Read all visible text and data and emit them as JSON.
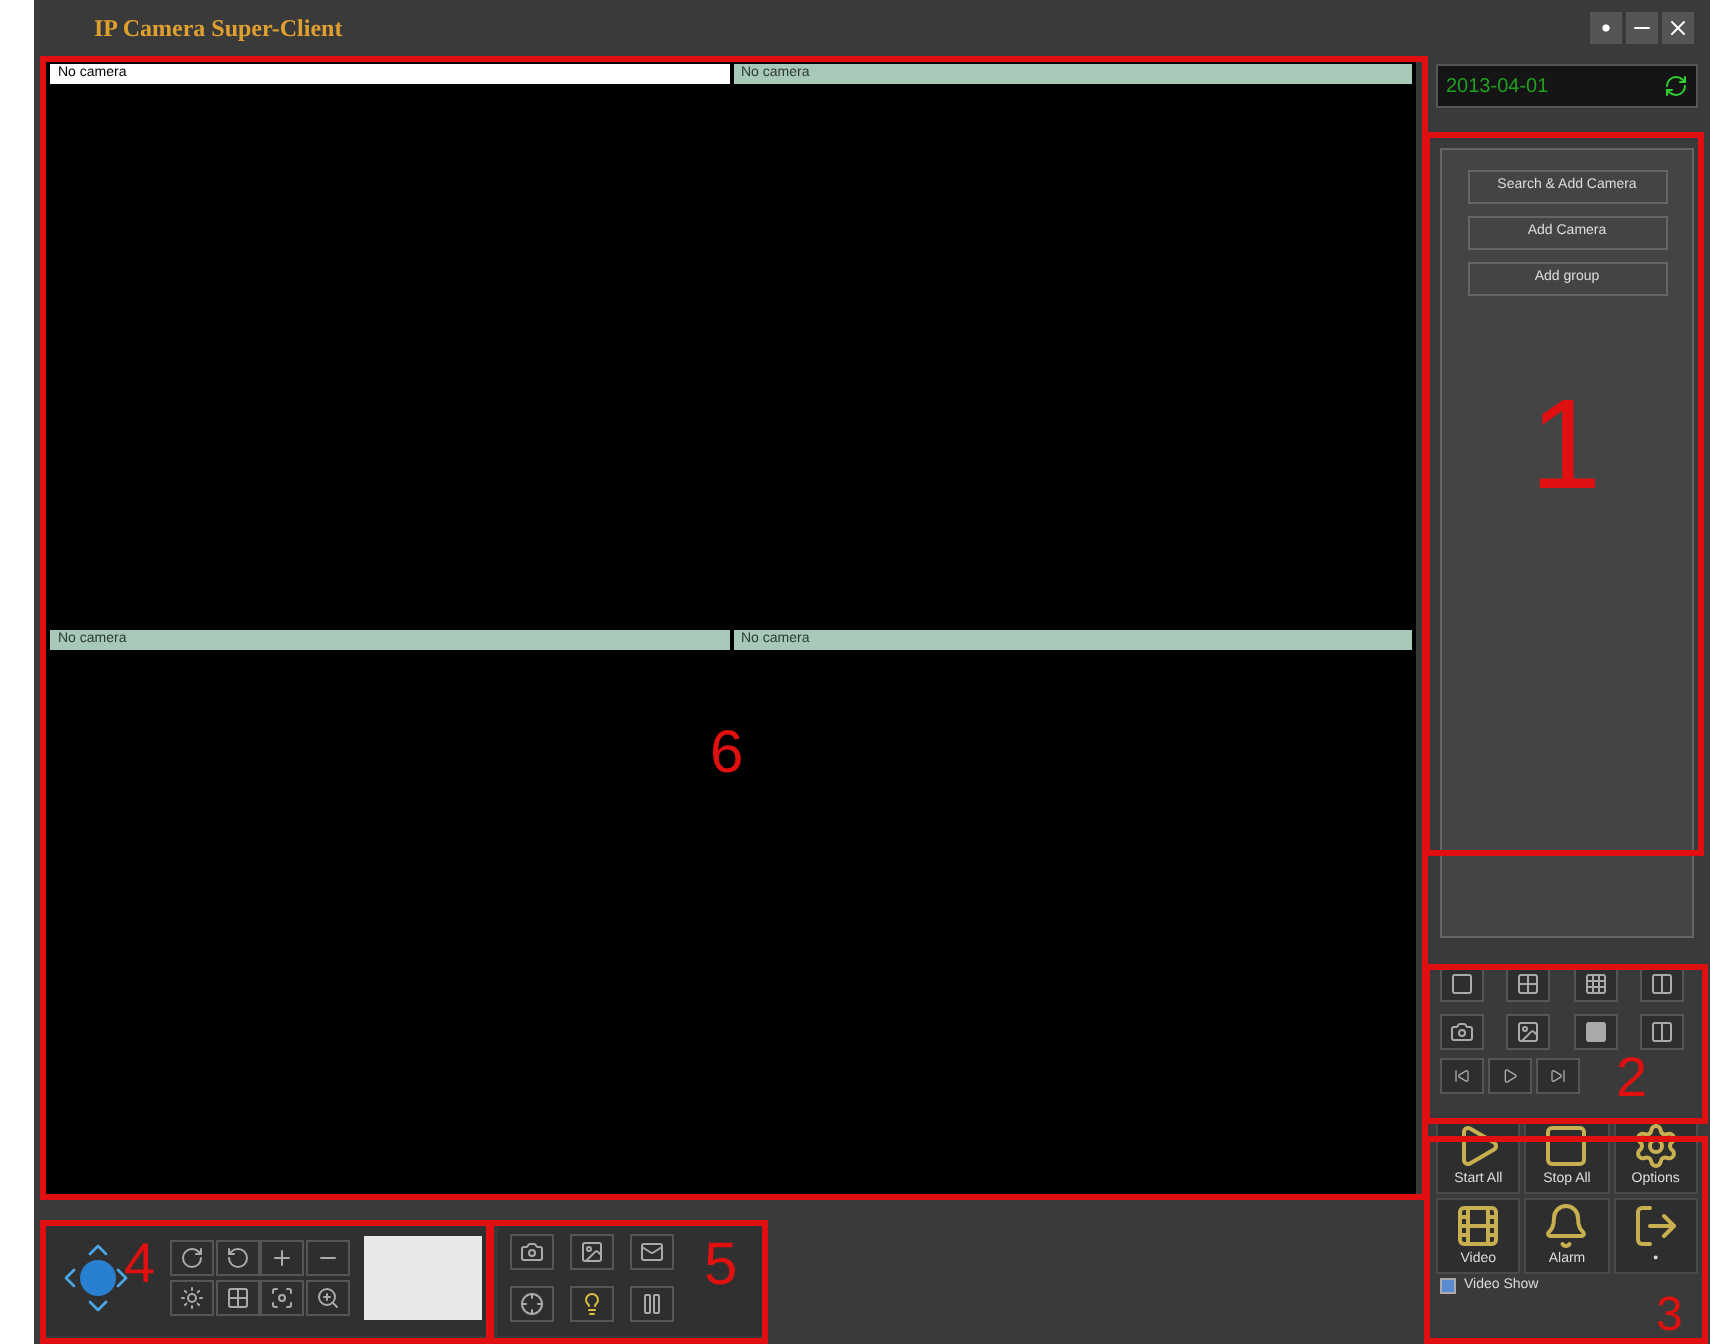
{
  "window": {
    "title": "IP Camera Super-Client"
  },
  "clock": "2013-04-01",
  "panes": [
    {
      "label": "No camera",
      "selected": true
    },
    {
      "label": "No camera",
      "selected": false
    },
    {
      "label": "No camera",
      "selected": false
    },
    {
      "label": "No camera",
      "selected": false
    }
  ],
  "camera_panel": {
    "buttons": [
      "Search & Add Camera",
      "Add Camera",
      "Add group"
    ]
  },
  "actions": [
    {
      "label": "Start All",
      "kind": "start"
    },
    {
      "label": "Stop All",
      "kind": "stop"
    },
    {
      "label": "Options",
      "kind": "options"
    },
    {
      "label": "Video",
      "kind": "video"
    },
    {
      "label": "Alarm",
      "kind": "alarm"
    },
    {
      "label": "•",
      "kind": "exit"
    }
  ],
  "video_show": {
    "label": "Video Show",
    "checked": true
  },
  "annotations": [
    {
      "label": "1"
    },
    {
      "label": "2"
    },
    {
      "label": "3"
    },
    {
      "label": "4"
    },
    {
      "label": "5"
    },
    {
      "label": "6"
    }
  ]
}
